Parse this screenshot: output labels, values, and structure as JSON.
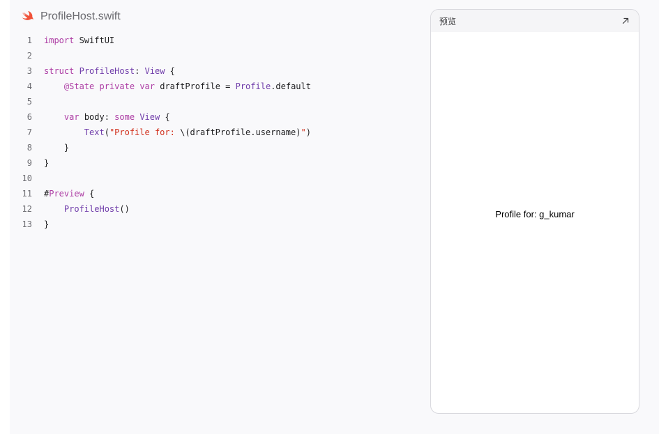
{
  "file": {
    "name": "ProfileHost.swift",
    "icon": "swift-logo-icon"
  },
  "colors": {
    "swift_orange": "#f05138",
    "keyword": "#ad3da4",
    "type": "#703daa",
    "string": "#d12f1b"
  },
  "code_lines": [
    {
      "n": "1",
      "tokens": [
        {
          "t": "import",
          "c": "kw"
        },
        {
          "t": " SwiftUI",
          "c": "pl"
        }
      ]
    },
    {
      "n": "2",
      "tokens": []
    },
    {
      "n": "3",
      "tokens": [
        {
          "t": "struct",
          "c": "kw"
        },
        {
          "t": " ",
          "c": "pl"
        },
        {
          "t": "ProfileHost",
          "c": "ty"
        },
        {
          "t": ": ",
          "c": "pl"
        },
        {
          "t": "View",
          "c": "ty"
        },
        {
          "t": " {",
          "c": "pl"
        }
      ]
    },
    {
      "n": "4",
      "tokens": [
        {
          "t": "    ",
          "c": "pl"
        },
        {
          "t": "@State",
          "c": "kw"
        },
        {
          "t": " ",
          "c": "pl"
        },
        {
          "t": "private",
          "c": "kw"
        },
        {
          "t": " ",
          "c": "pl"
        },
        {
          "t": "var",
          "c": "kw"
        },
        {
          "t": " draftProfile = ",
          "c": "pl"
        },
        {
          "t": "Profile",
          "c": "ty"
        },
        {
          "t": ".default",
          "c": "pl"
        }
      ]
    },
    {
      "n": "5",
      "tokens": []
    },
    {
      "n": "6",
      "tokens": [
        {
          "t": "    ",
          "c": "pl"
        },
        {
          "t": "var",
          "c": "kw"
        },
        {
          "t": " body: ",
          "c": "pl"
        },
        {
          "t": "some",
          "c": "kw"
        },
        {
          "t": " ",
          "c": "pl"
        },
        {
          "t": "View",
          "c": "ty"
        },
        {
          "t": " {",
          "c": "pl"
        }
      ]
    },
    {
      "n": "7",
      "tokens": [
        {
          "t": "        ",
          "c": "pl"
        },
        {
          "t": "Text",
          "c": "ty"
        },
        {
          "t": "(",
          "c": "pl"
        },
        {
          "t": "\"Profile for: ",
          "c": "st"
        },
        {
          "t": "\\(draftProfile.username)",
          "c": "pl"
        },
        {
          "t": "\"",
          "c": "st"
        },
        {
          "t": ")",
          "c": "pl"
        }
      ]
    },
    {
      "n": "8",
      "tokens": [
        {
          "t": "    }",
          "c": "pl"
        }
      ]
    },
    {
      "n": "9",
      "tokens": [
        {
          "t": "}",
          "c": "pl"
        }
      ]
    },
    {
      "n": "10",
      "tokens": []
    },
    {
      "n": "11",
      "tokens": [
        {
          "t": "#",
          "c": "pl"
        },
        {
          "t": "Preview",
          "c": "kw"
        },
        {
          "t": " {",
          "c": "pl"
        }
      ]
    },
    {
      "n": "12",
      "tokens": [
        {
          "t": "    ",
          "c": "pl"
        },
        {
          "t": "ProfileHost",
          "c": "ty"
        },
        {
          "t": "()",
          "c": "pl"
        }
      ]
    },
    {
      "n": "13",
      "tokens": [
        {
          "t": "}",
          "c": "pl"
        }
      ]
    }
  ],
  "preview": {
    "title": "预览",
    "expand_icon": "expand-arrow-icon",
    "rendered_text": "Profile for: g_kumar"
  }
}
